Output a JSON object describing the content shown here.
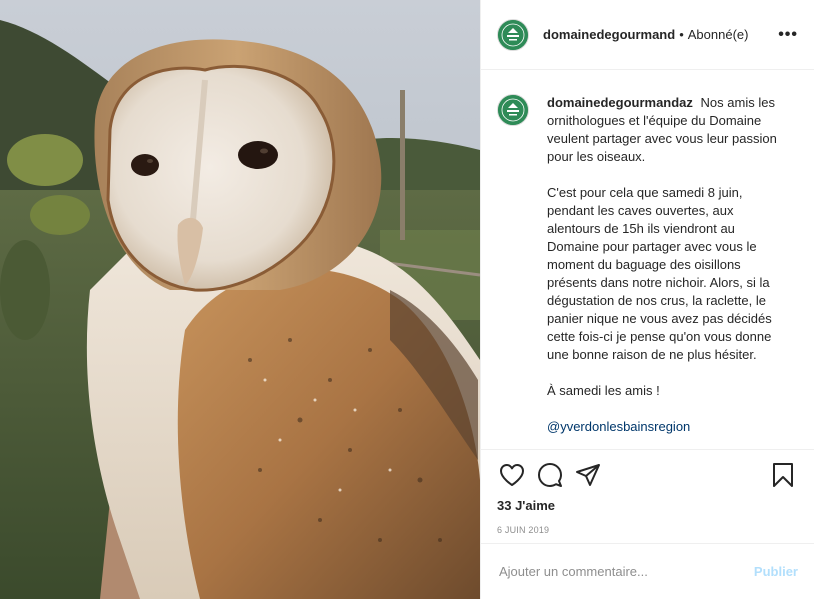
{
  "header": {
    "username": "domainedegourmand",
    "separator": "•",
    "follow_status": "Abonné(e)",
    "more_label": "•••"
  },
  "caption": {
    "username": "domainedegourmandaz",
    "intro": "Nos amis les ornithologues et l'équipe du Domaine veulent partager avec vous leur passion pour les oiseaux.",
    "body": "C'est pour cela que samedi 8 juin, pendant les caves ouvertes, aux alentours de 15h ils viendront au Domaine pour partager avec vous le moment du baguage des oisillons présents dans notre nichoir. Alors, si la dégustation de nos crus, la raclette, le panier nique ne vous avez pas décidés cette fois-ci je pense qu'on vous donne une bonne raison de ne plus hésiter.",
    "closing": "À samedi les amis !",
    "mention": "@yverdonlesbainsregion"
  },
  "actions": {
    "likes": "33 J'aime",
    "date": "6 JUIN 2019"
  },
  "comment_box": {
    "placeholder": "Ajouter un commentaire...",
    "post_label": "Publier"
  },
  "icons": {
    "avatar": "domaine-logo-icon",
    "like": "heart-icon",
    "comment": "comment-icon",
    "share": "send-icon",
    "save": "bookmark-icon",
    "more": "more-options-icon"
  },
  "colors": {
    "brand_green": "#2e8b57",
    "link": "#00376b",
    "publish_disabled": "#b2dffc",
    "muted": "#8e8e8e"
  }
}
